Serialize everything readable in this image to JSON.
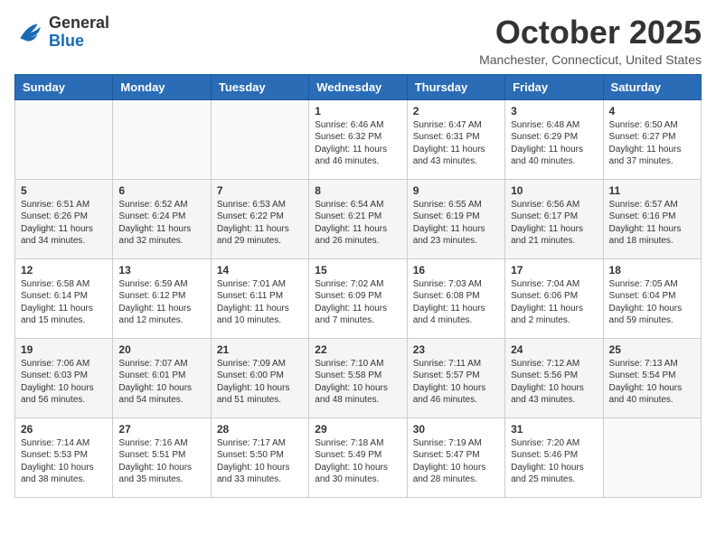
{
  "logo": {
    "text_general": "General",
    "text_blue": "Blue"
  },
  "title": "October 2025",
  "location": "Manchester, Connecticut, United States",
  "days_of_week": [
    "Sunday",
    "Monday",
    "Tuesday",
    "Wednesday",
    "Thursday",
    "Friday",
    "Saturday"
  ],
  "weeks": [
    [
      {
        "day": "",
        "content": ""
      },
      {
        "day": "",
        "content": ""
      },
      {
        "day": "",
        "content": ""
      },
      {
        "day": "1",
        "content": "Sunrise: 6:46 AM\nSunset: 6:32 PM\nDaylight: 11 hours and 46 minutes."
      },
      {
        "day": "2",
        "content": "Sunrise: 6:47 AM\nSunset: 6:31 PM\nDaylight: 11 hours and 43 minutes."
      },
      {
        "day": "3",
        "content": "Sunrise: 6:48 AM\nSunset: 6:29 PM\nDaylight: 11 hours and 40 minutes."
      },
      {
        "day": "4",
        "content": "Sunrise: 6:50 AM\nSunset: 6:27 PM\nDaylight: 11 hours and 37 minutes."
      }
    ],
    [
      {
        "day": "5",
        "content": "Sunrise: 6:51 AM\nSunset: 6:26 PM\nDaylight: 11 hours and 34 minutes."
      },
      {
        "day": "6",
        "content": "Sunrise: 6:52 AM\nSunset: 6:24 PM\nDaylight: 11 hours and 32 minutes."
      },
      {
        "day": "7",
        "content": "Sunrise: 6:53 AM\nSunset: 6:22 PM\nDaylight: 11 hours and 29 minutes."
      },
      {
        "day": "8",
        "content": "Sunrise: 6:54 AM\nSunset: 6:21 PM\nDaylight: 11 hours and 26 minutes."
      },
      {
        "day": "9",
        "content": "Sunrise: 6:55 AM\nSunset: 6:19 PM\nDaylight: 11 hours and 23 minutes."
      },
      {
        "day": "10",
        "content": "Sunrise: 6:56 AM\nSunset: 6:17 PM\nDaylight: 11 hours and 21 minutes."
      },
      {
        "day": "11",
        "content": "Sunrise: 6:57 AM\nSunset: 6:16 PM\nDaylight: 11 hours and 18 minutes."
      }
    ],
    [
      {
        "day": "12",
        "content": "Sunrise: 6:58 AM\nSunset: 6:14 PM\nDaylight: 11 hours and 15 minutes."
      },
      {
        "day": "13",
        "content": "Sunrise: 6:59 AM\nSunset: 6:12 PM\nDaylight: 11 hours and 12 minutes."
      },
      {
        "day": "14",
        "content": "Sunrise: 7:01 AM\nSunset: 6:11 PM\nDaylight: 11 hours and 10 minutes."
      },
      {
        "day": "15",
        "content": "Sunrise: 7:02 AM\nSunset: 6:09 PM\nDaylight: 11 hours and 7 minutes."
      },
      {
        "day": "16",
        "content": "Sunrise: 7:03 AM\nSunset: 6:08 PM\nDaylight: 11 hours and 4 minutes."
      },
      {
        "day": "17",
        "content": "Sunrise: 7:04 AM\nSunset: 6:06 PM\nDaylight: 11 hours and 2 minutes."
      },
      {
        "day": "18",
        "content": "Sunrise: 7:05 AM\nSunset: 6:04 PM\nDaylight: 10 hours and 59 minutes."
      }
    ],
    [
      {
        "day": "19",
        "content": "Sunrise: 7:06 AM\nSunset: 6:03 PM\nDaylight: 10 hours and 56 minutes."
      },
      {
        "day": "20",
        "content": "Sunrise: 7:07 AM\nSunset: 6:01 PM\nDaylight: 10 hours and 54 minutes."
      },
      {
        "day": "21",
        "content": "Sunrise: 7:09 AM\nSunset: 6:00 PM\nDaylight: 10 hours and 51 minutes."
      },
      {
        "day": "22",
        "content": "Sunrise: 7:10 AM\nSunset: 5:58 PM\nDaylight: 10 hours and 48 minutes."
      },
      {
        "day": "23",
        "content": "Sunrise: 7:11 AM\nSunset: 5:57 PM\nDaylight: 10 hours and 46 minutes."
      },
      {
        "day": "24",
        "content": "Sunrise: 7:12 AM\nSunset: 5:56 PM\nDaylight: 10 hours and 43 minutes."
      },
      {
        "day": "25",
        "content": "Sunrise: 7:13 AM\nSunset: 5:54 PM\nDaylight: 10 hours and 40 minutes."
      }
    ],
    [
      {
        "day": "26",
        "content": "Sunrise: 7:14 AM\nSunset: 5:53 PM\nDaylight: 10 hours and 38 minutes."
      },
      {
        "day": "27",
        "content": "Sunrise: 7:16 AM\nSunset: 5:51 PM\nDaylight: 10 hours and 35 minutes."
      },
      {
        "day": "28",
        "content": "Sunrise: 7:17 AM\nSunset: 5:50 PM\nDaylight: 10 hours and 33 minutes."
      },
      {
        "day": "29",
        "content": "Sunrise: 7:18 AM\nSunset: 5:49 PM\nDaylight: 10 hours and 30 minutes."
      },
      {
        "day": "30",
        "content": "Sunrise: 7:19 AM\nSunset: 5:47 PM\nDaylight: 10 hours and 28 minutes."
      },
      {
        "day": "31",
        "content": "Sunrise: 7:20 AM\nSunset: 5:46 PM\nDaylight: 10 hours and 25 minutes."
      },
      {
        "day": "",
        "content": ""
      }
    ]
  ]
}
